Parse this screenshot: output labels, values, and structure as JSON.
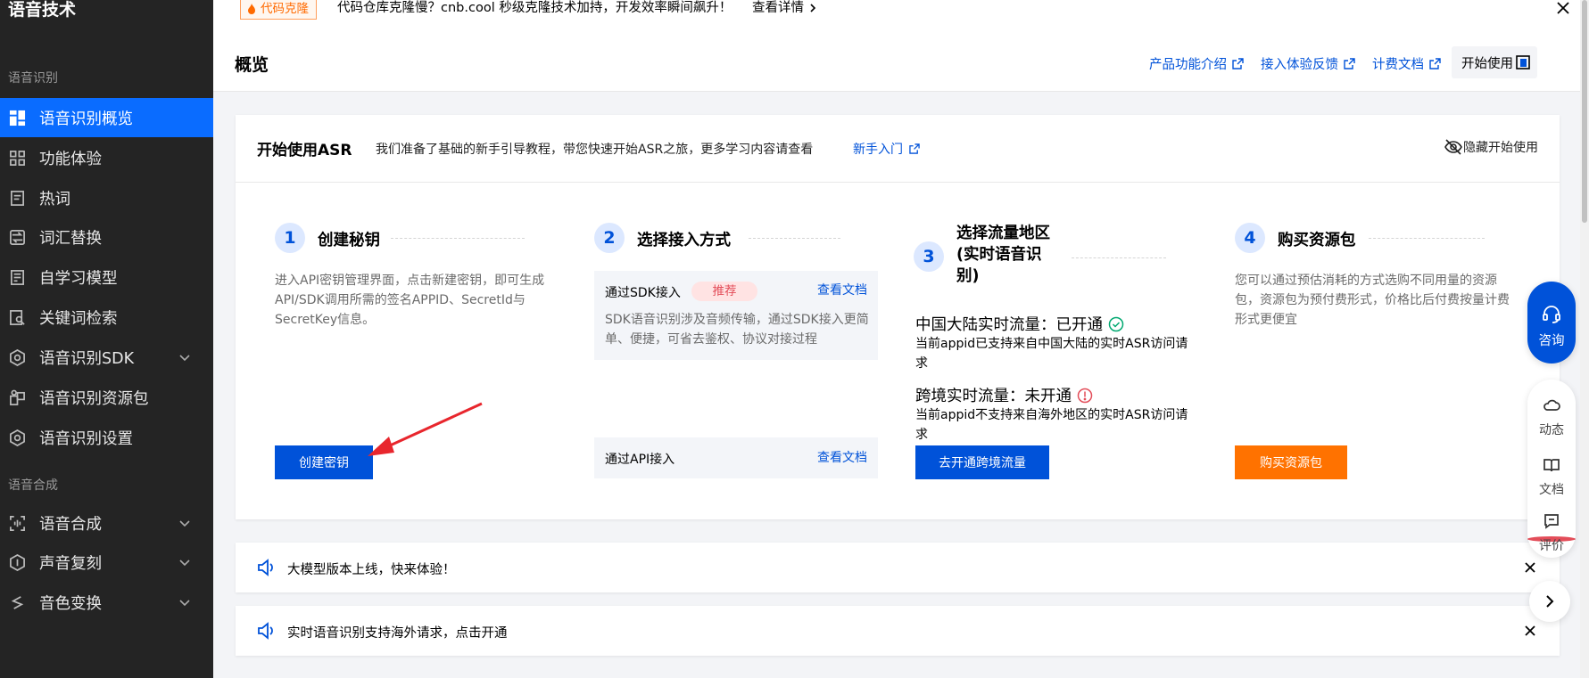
{
  "sidebar": {
    "title": "语音技术",
    "group1": "语音识别",
    "group2": "语音合成",
    "items": [
      {
        "label": "语音识别概览",
        "icon": "dashboard-icon"
      },
      {
        "label": "功能体验",
        "icon": "grid-icon"
      },
      {
        "label": "热词",
        "icon": "document-icon"
      },
      {
        "label": "词汇替换",
        "icon": "swap-icon"
      },
      {
        "label": "自学习模型",
        "icon": "model-icon"
      },
      {
        "label": "关键词检索",
        "icon": "search-doc-icon"
      },
      {
        "label": "语音识别SDK",
        "icon": "sdk-icon"
      },
      {
        "label": "语音识别资源包",
        "icon": "package-icon"
      },
      {
        "label": "语音识别设置",
        "icon": "settings-icon"
      },
      {
        "label": "语音合成",
        "icon": "synthesis-icon"
      },
      {
        "label": "声音复刻",
        "icon": "clone-icon"
      },
      {
        "label": "音色变换",
        "icon": "voice-change-icon"
      }
    ]
  },
  "topbar": {
    "tag": "代码克隆",
    "text": "代码仓库克隆慢？cnb.cool 秒级克隆技术加持，开发效率瞬间飙升！",
    "link": "查看详情"
  },
  "header": {
    "title": "概览",
    "links": [
      "产品功能介绍",
      "接入体验反馈",
      "计费文档"
    ],
    "start_button": "开始使用"
  },
  "card": {
    "title": "开始使用ASR",
    "desc": "我们准备了基础的新手引导教程，带您快速开始ASR之旅，更多学习内容请查看",
    "link": "新手入门",
    "hide": "隐藏开始使用",
    "steps": [
      {
        "num": "1",
        "title": "创建秘钥",
        "desc": "进入API密钥管理界面，点击新建密钥，即可生成API/SDK调用所需的签名APPID、SecretId与SecretKey信息。",
        "button": "创建密钥"
      },
      {
        "num": "2",
        "title": "选择接入方式",
        "sdk_label": "通过SDK接入",
        "sdk_tag": "推荐",
        "sdk_link": "查看文档",
        "sdk_desc": "SDK语音识别涉及音频传输，通过SDK接入更简单、便捷，可省去鉴权、协议对接过程",
        "api_label": "通过API接入",
        "api_link": "查看文档"
      },
      {
        "num": "3",
        "title_line1": "选择流量地区",
        "title_line2": "(实时语音识",
        "title_line3": "别)",
        "mainland_label": "中国大陆实时流量：已开通",
        "mainland_desc": "当前appid已支持来自中国大陆的实时ASR访问请求",
        "cross_label": "跨境实时流量：未开通",
        "cross_desc": "当前appid不支持来自海外地区的实时ASR访问请求",
        "button": "去开通跨境流量"
      },
      {
        "num": "4",
        "title": "购买资源包",
        "desc": "您可以通过预估消耗的方式选购不同用量的资源包，资源包为预付费形式，价格比后付费按量计费形式更便宜",
        "button": "购买资源包"
      }
    ]
  },
  "notices": [
    {
      "text": "大模型版本上线，快来体验！"
    },
    {
      "text": "实时语音识别支持海外请求，点击开通"
    }
  ],
  "float": {
    "consult": "咨询",
    "items": [
      "动态",
      "文档",
      "评价"
    ]
  },
  "colors": {
    "accent": "#0052d9",
    "sidebar_active": "#0a6cff",
    "sidebar_bg": "#242424",
    "orange": "#ff7200",
    "success": "#00a870",
    "danger": "#e34d59"
  }
}
